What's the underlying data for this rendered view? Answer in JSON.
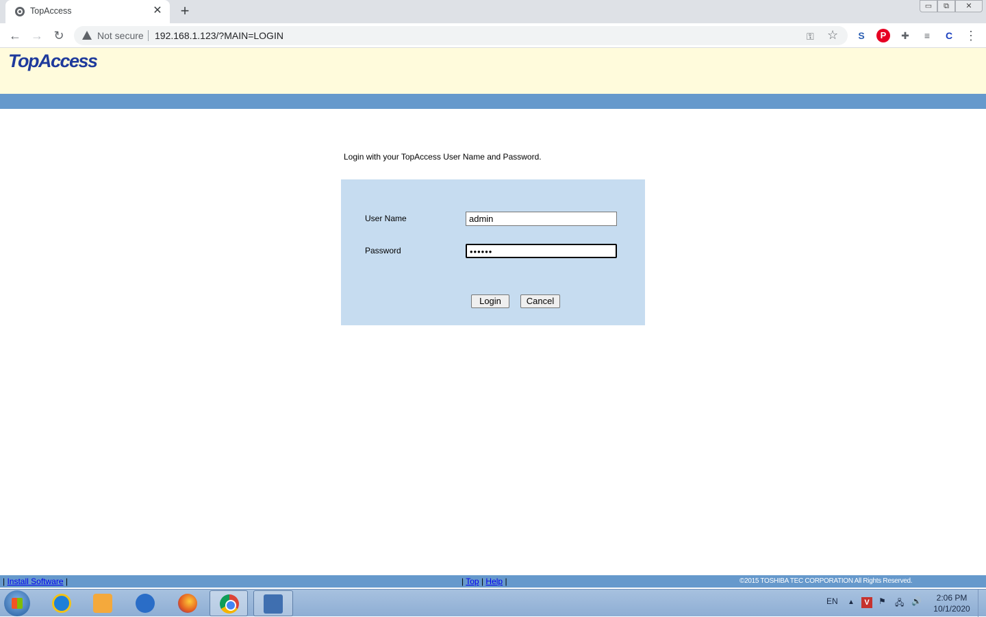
{
  "browser": {
    "tab_title": "TopAccess",
    "tab_close": "✕",
    "new_tab": "+",
    "window_controls": {
      "minimize": "▭",
      "maximize": "⧉",
      "close": "✕"
    },
    "nav": {
      "back": "←",
      "forward": "→",
      "reload": "↻"
    },
    "security_label": "Not secure",
    "url": "192.168.1.123/?MAIN=LOGIN",
    "icons": [
      "warning-icon",
      "key-icon",
      "star-icon",
      "extension-icon",
      "pinterest-icon",
      "puzzle-icon",
      "media-queue-icon",
      "profile-extension-icon",
      "menu-icon"
    ],
    "icon_glyphs": {
      "key": "⚿",
      "star": "☆",
      "ext1": "S",
      "pinterest": "P",
      "puzzle": "✚",
      "queue": "≡",
      "profile": "C",
      "menu": "⋮"
    }
  },
  "page": {
    "logo_text": "TopAccess",
    "instructions": "Login with your TopAccess User Name and Password.",
    "form": {
      "username_label": "User Name",
      "username_value": "admin",
      "password_label": "Password",
      "password_value": "••••••",
      "login_button": "Login",
      "cancel_button": "Cancel"
    },
    "footer": {
      "left_sep": "|",
      "install_software": "Install Software",
      "pipe": "|",
      "top": "Top",
      "help": "Help",
      "copyright": "©2015 TOSHIBA TEC CORPORATION All Rights Reserved."
    },
    "colors": {
      "banner": "#fffbdc",
      "bar": "#6699cc",
      "login_box": "#c6dcf0",
      "logo": "#1e3a9c"
    }
  },
  "taskbar": {
    "apps": [
      "start-button",
      "internet-explorer",
      "media-player",
      "remote-desktop",
      "firefox",
      "chrome",
      "control-panel"
    ],
    "language": "EN",
    "tray_up": "▲",
    "tray_v": "V",
    "tray_flag": "⚑",
    "tray_net": "🖧",
    "tray_vol": "🔊",
    "time": "2:06 PM",
    "date": "10/1/2020"
  }
}
